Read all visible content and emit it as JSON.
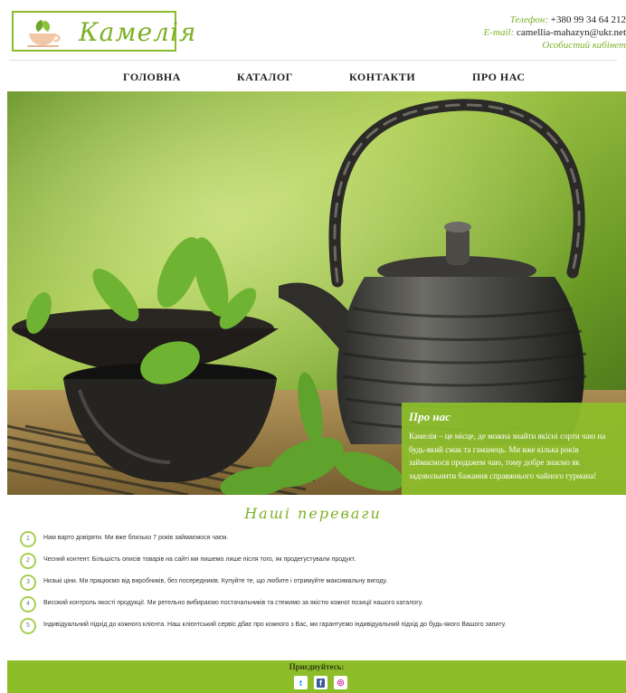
{
  "header": {
    "logo_text": "Камелія",
    "phone_label": "Телефон:",
    "phone": "+380 99 34 64 212",
    "email_label": "E-mail:",
    "email": "camellia-mahazyn@ukr.net",
    "cabinet": "Особистий кабінет"
  },
  "nav": {
    "items": [
      {
        "label": "ГОЛОВНА"
      },
      {
        "label": "КАТАЛОГ"
      },
      {
        "label": "КОНТАКТИ"
      },
      {
        "label": "ПРО НАС"
      }
    ]
  },
  "about": {
    "title": "Про нас",
    "text": "Камелія – це місце, де можна знайти якісні сорти чаю на будь-який смак та гаманець. Ми вже кілька років займаємося продажем чаю, тому добре знаємо як задовольнити бажання справжнього чайного гурмана!"
  },
  "advantages": {
    "title": "Наші переваги",
    "items": [
      {
        "num": "1",
        "text": "Нам варто довіряти. Ми вже близько 7 років займаємося чаєм."
      },
      {
        "num": "2",
        "text": "Чесний контент. Більшість описів товарів на сайті ми пишемо лише після того, як продегустували продукт."
      },
      {
        "num": "3",
        "text": "Низькі ціни. Ми працюємо від виробників, без посередників. Купуйте те, що любите і отримуйте максимальну вигоду."
      },
      {
        "num": "4",
        "text": "Високий контроль якості продукції. Ми ретельно вибираємо постачальників та стежимо за якістю кожної позиції нашого каталогу."
      },
      {
        "num": "5",
        "text": "Індивідуальний підхід до кожного клієнта. Наш клієнтський сервіс дбає про кожного з Вас, ми гарантуємо індивідуальний підхід до будь-якого Вашого запиту."
      }
    ]
  },
  "footer": {
    "join_label": "Приєднуйтесь:",
    "social": [
      {
        "icon": "twitter-icon",
        "glyph": "t",
        "color": "#1da1f2"
      },
      {
        "icon": "facebook-icon",
        "glyph": "f",
        "color": "#3b5998"
      },
      {
        "icon": "instagram-icon",
        "glyph": "◎",
        "color": "#d6249f"
      }
    ]
  },
  "colors": {
    "accent": "#8dbe2a",
    "accent_text": "#7db126"
  }
}
